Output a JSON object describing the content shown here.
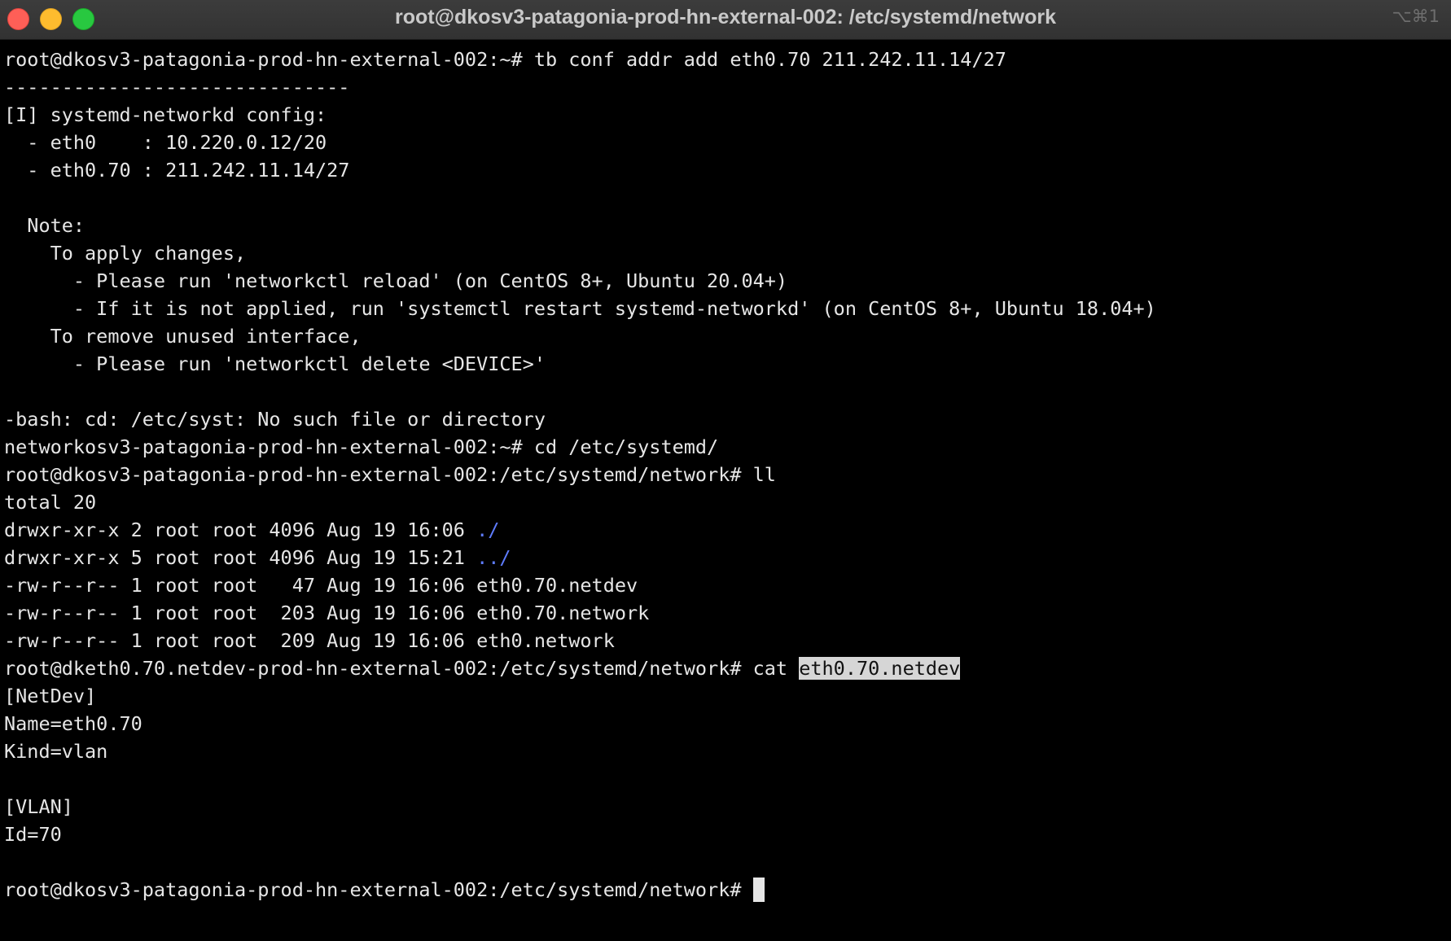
{
  "window": {
    "title": "root@dkosv3-patagonia-prod-hn-external-002: /etc/systemd/network",
    "shortcut": "⌥⌘1"
  },
  "terminal": {
    "lines": {
      "l0": "root@dkosv3-patagonia-prod-hn-external-002:~# tb conf addr add eth0.70 211.242.11.14/27",
      "l1": "------------------------------",
      "l2": "[I] systemd-networkd config:",
      "l3": "  - eth0    : 10.220.0.12/20",
      "l4": "  - eth0.70 : 211.242.11.14/27",
      "l5": "",
      "l6": "  Note:",
      "l7": "    To apply changes,",
      "l8": "      - Please run 'networkctl reload' (on CentOS 8+, Ubuntu 20.04+)",
      "l9": "      - If it is not applied, run 'systemctl restart systemd-networkd' (on CentOS 8+, Ubuntu 18.04+)",
      "l10": "    To remove unused interface,",
      "l11": "      - Please run 'networkctl delete <DEVICE>'",
      "l12": "",
      "l13": "-bash: cd: /etc/syst: No such file or directory",
      "l14": "networkosv3-patagonia-prod-hn-external-002:~# cd /etc/systemd/",
      "l15": "root@dkosv3-patagonia-prod-hn-external-002:/etc/systemd/network# ll",
      "l16": "total 20",
      "l17": {
        "prefix": "drwxr-xr-x 2 root root 4096 Aug 19 16:06 ",
        "name": "./"
      },
      "l18": {
        "prefix": "drwxr-xr-x 5 root root 4096 Aug 19 15:21 ",
        "name": "../"
      },
      "l19": "-rw-r--r-- 1 root root   47 Aug 19 16:06 eth0.70.netdev",
      "l20": "-rw-r--r-- 1 root root  203 Aug 19 16:06 eth0.70.network",
      "l21": "-rw-r--r-- 1 root root  209 Aug 19 16:06 eth0.network",
      "l22": {
        "prefix": "root@dketh0.70.netdev-prod-hn-external-002:/etc/systemd/network# cat ",
        "selected": "eth0.70.netdev"
      },
      "l23": "[NetDev]",
      "l24": "Name=eth0.70",
      "l25": "Kind=vlan",
      "l26": "",
      "l27": "[VLAN]",
      "l28": "Id=70",
      "l29": "",
      "l30": "root@dkosv3-patagonia-prod-hn-external-002:/etc/systemd/network# "
    }
  },
  "colors": {
    "background": "#000000",
    "text": "#e6e6e6",
    "directory": "#5e7cff",
    "selection": "#d6d6d6",
    "titlebar": "#363636",
    "close": "#fe5f57",
    "minimize": "#febc2e",
    "maximize": "#28c840"
  }
}
